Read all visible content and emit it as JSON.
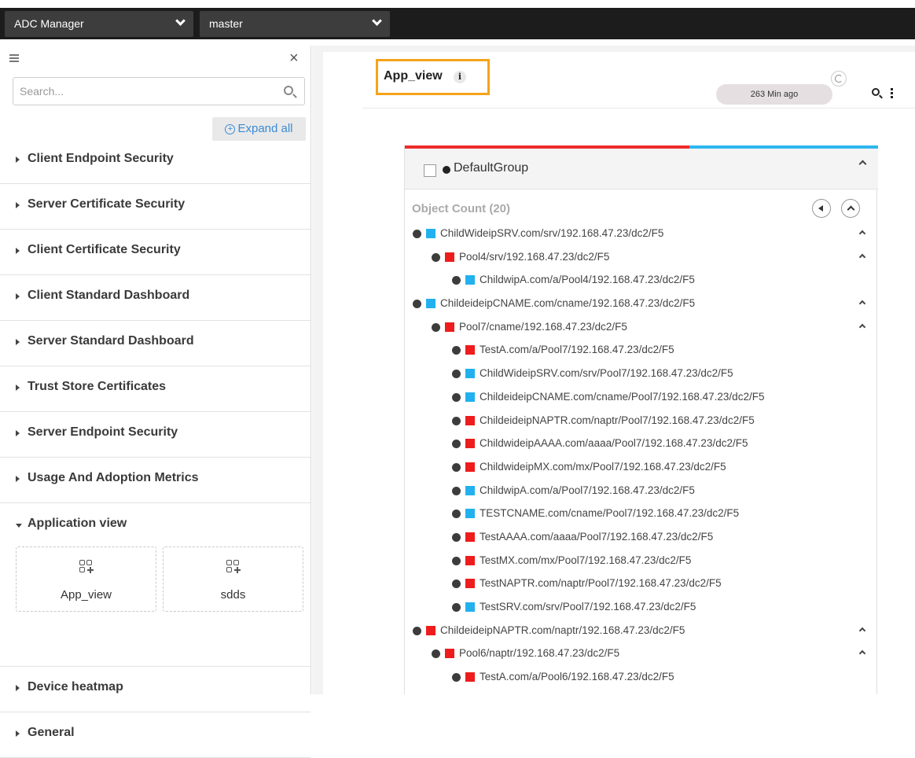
{
  "topbar": {
    "app_select": "ADC Manager",
    "branch_select": "master"
  },
  "sidebar": {
    "search_placeholder": "Search...",
    "expand_all": "Expand all",
    "items": [
      {
        "label": "Client Endpoint Security"
      },
      {
        "label": "Server Certificate Security"
      },
      {
        "label": "Client Certificate Security"
      },
      {
        "label": "Client Standard Dashboard"
      },
      {
        "label": "Server Standard Dashboard"
      },
      {
        "label": "Trust Store Certificates"
      },
      {
        "label": "Server Endpoint Security"
      },
      {
        "label": "Usage And Adoption Metrics"
      },
      {
        "label": "Application view",
        "expanded": true
      },
      {
        "label": "Device heatmap"
      },
      {
        "label": "General"
      }
    ],
    "app_tiles": [
      {
        "label": "App_view",
        "icon": "add-app-icon"
      },
      {
        "label": "sdds",
        "icon": "add-app-icon"
      }
    ]
  },
  "main": {
    "title": "App_view",
    "info_icon": "i",
    "last_updated": "263 Min ago",
    "group": {
      "name": "DefaultGroup",
      "object_count": "Object Count (20)",
      "bar_colors": [
        "#ee2c2c",
        "#2eb7ef"
      ]
    },
    "colors": {
      "red": "#ee1c1c",
      "blue": "#22b1ee"
    },
    "tree": [
      {
        "text": "ChildWideipSRV.com/srv/192.168.47.23/dc2/F5",
        "level": 0,
        "status": "blue",
        "collapsible": true
      },
      {
        "text": "Pool4/srv/192.168.47.23/dc2/F5",
        "level": 1,
        "status": "red",
        "collapsible": true
      },
      {
        "text": "ChildwipA.com/a/Pool4/192.168.47.23/dc2/F5",
        "level": 2,
        "status": "blue",
        "collapsible": false
      },
      {
        "text": "ChildeideipCNAME.com/cname/192.168.47.23/dc2/F5",
        "level": 0,
        "status": "blue",
        "collapsible": true
      },
      {
        "text": "Pool7/cname/192.168.47.23/dc2/F5",
        "level": 1,
        "status": "red",
        "collapsible": true
      },
      {
        "text": "TestA.com/a/Pool7/192.168.47.23/dc2/F5",
        "level": 2,
        "status": "red",
        "collapsible": false
      },
      {
        "text": "ChildWideipSRV.com/srv/Pool7/192.168.47.23/dc2/F5",
        "level": 2,
        "status": "blue",
        "collapsible": false
      },
      {
        "text": "ChildeideipCNAME.com/cname/Pool7/192.168.47.23/dc2/F5",
        "level": 2,
        "status": "blue",
        "collapsible": false
      },
      {
        "text": "ChildeideipNAPTR.com/naptr/Pool7/192.168.47.23/dc2/F5",
        "level": 2,
        "status": "red",
        "collapsible": false
      },
      {
        "text": "ChildwideipAAAA.com/aaaa/Pool7/192.168.47.23/dc2/F5",
        "level": 2,
        "status": "red",
        "collapsible": false
      },
      {
        "text": "ChildwideipMX.com/mx/Pool7/192.168.47.23/dc2/F5",
        "level": 2,
        "status": "red",
        "collapsible": false
      },
      {
        "text": "ChildwipA.com/a/Pool7/192.168.47.23/dc2/F5",
        "level": 2,
        "status": "blue",
        "collapsible": false
      },
      {
        "text": "TESTCNAME.com/cname/Pool7/192.168.47.23/dc2/F5",
        "level": 2,
        "status": "blue",
        "collapsible": false
      },
      {
        "text": "TestAAAA.com/aaaa/Pool7/192.168.47.23/dc2/F5",
        "level": 2,
        "status": "red",
        "collapsible": false
      },
      {
        "text": "TestMX.com/mx/Pool7/192.168.47.23/dc2/F5",
        "level": 2,
        "status": "red",
        "collapsible": false
      },
      {
        "text": "TestNAPTR.com/naptr/Pool7/192.168.47.23/dc2/F5",
        "level": 2,
        "status": "red",
        "collapsible": false
      },
      {
        "text": "TestSRV.com/srv/Pool7/192.168.47.23/dc2/F5",
        "level": 2,
        "status": "blue",
        "collapsible": false
      },
      {
        "text": "ChildeideipNAPTR.com/naptr/192.168.47.23/dc2/F5",
        "level": 0,
        "status": "red",
        "collapsible": true
      },
      {
        "text": "Pool6/naptr/192.168.47.23/dc2/F5",
        "level": 1,
        "status": "red",
        "collapsible": true
      },
      {
        "text": "TestA.com/a/Pool6/192.168.47.23/dc2/F5",
        "level": 2,
        "status": "red",
        "collapsible": false
      }
    ]
  }
}
